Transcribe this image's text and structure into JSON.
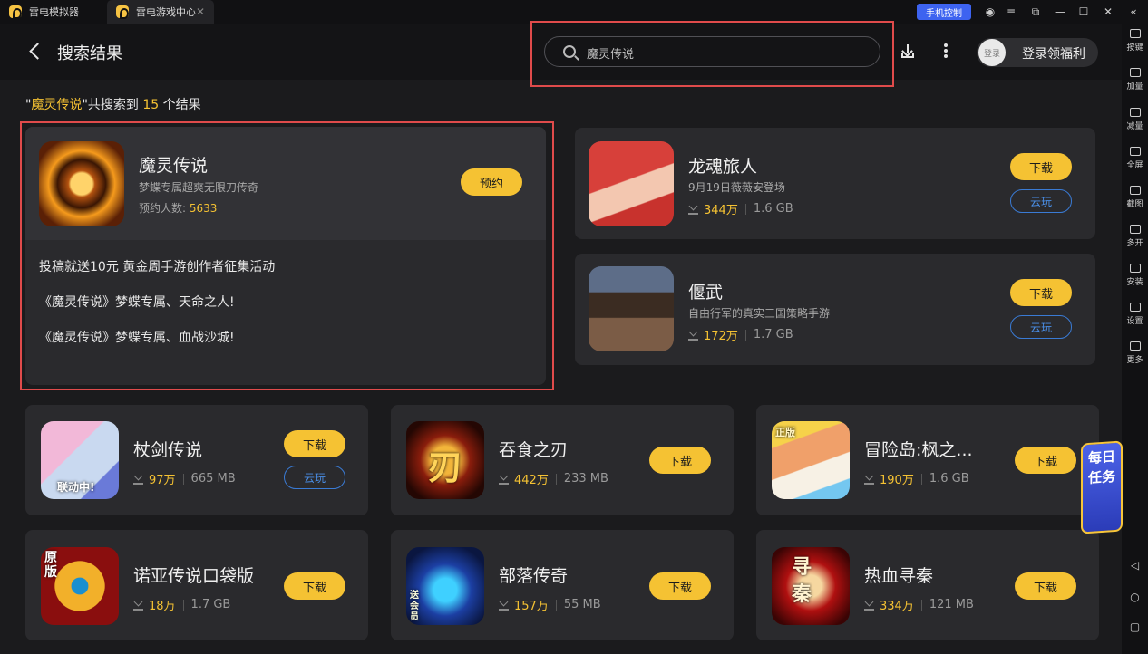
{
  "titlebar": {
    "tab1": "雷电模拟器",
    "tab2": "雷电游戏中心",
    "phone_control": "手机控制"
  },
  "sidebar": {
    "items": [
      "按键",
      "加量",
      "减量",
      "全屏",
      "截图",
      "多开",
      "安装",
      "设置",
      "更多"
    ]
  },
  "header": {
    "title": "搜索结果",
    "search_value": "魔灵传说",
    "login_avatar": "登录",
    "login_label": "登录领福利"
  },
  "results": {
    "prefix": "\"",
    "query": "魔灵传说",
    "mid": "\"共搜索到 ",
    "count": "15",
    "suffix": " 个结果"
  },
  "featured": {
    "name": "魔灵传说",
    "subtitle": "梦蝶专属超爽无限刀传奇",
    "reserve_label": "预约人数:",
    "reserve_count": "5633",
    "button": "预约",
    "news": [
      "投稿就送10元 黄金周手游创作者征集活动",
      "《魔灵传说》梦蝶专属、天命之人!",
      "《魔灵传说》梦蝶专属、血战沙城!"
    ]
  },
  "games": [
    {
      "name": "龙魂旅人",
      "subtitle": "9月19日薇薇安登场",
      "downloads": "344万",
      "size": "1.6 GB",
      "button": "下载",
      "cloud": "云玩"
    },
    {
      "name": "偃武",
      "subtitle": "自由行军的真实三国策略手游",
      "downloads": "172万",
      "size": "1.7 GB",
      "button": "下载",
      "cloud": "云玩"
    },
    {
      "name": "杖剑传说",
      "downloads": "97万",
      "size": "665 MB",
      "button": "下载",
      "cloud": "云玩",
      "thumb_label": "联动中!"
    },
    {
      "name": "吞食之刃",
      "downloads": "442万",
      "size": "233 MB",
      "button": "下载",
      "thumb_label": "刃"
    },
    {
      "name": "冒险岛:枫之...",
      "downloads": "190万",
      "size": "1.6 GB",
      "button": "下载",
      "thumb_label": "正版"
    },
    {
      "name": "诺亚传说口袋版",
      "downloads": "18万",
      "size": "1.7 GB",
      "button": "下载",
      "thumb_label": "原版"
    },
    {
      "name": "部落传奇",
      "downloads": "157万",
      "size": "55 MB",
      "button": "下载",
      "thumb_label": "送会员"
    },
    {
      "name": "热血寻秦",
      "downloads": "334万",
      "size": "121 MB",
      "button": "下载",
      "thumb_label": "寻秦"
    }
  ],
  "daily_task": "每日任务",
  "colors": {
    "accent": "#f5c233",
    "background": "#1b1b1d",
    "card": "#2a2a2d",
    "highlight_box": "#e04b4b",
    "cloud_button": "#3a7bd5"
  }
}
